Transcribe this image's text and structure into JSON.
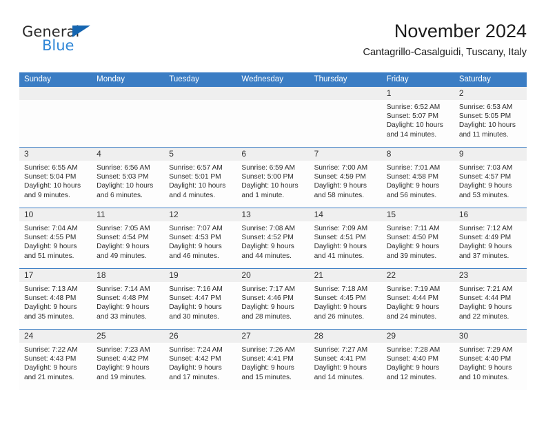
{
  "brand": {
    "name_part1": "General",
    "name_part2": "Blue",
    "triangle_color": "#1565b0",
    "blue_color": "#2f86d6"
  },
  "header": {
    "title": "November 2024",
    "subtitle": "Cantagrillo-Casalguidi, Tuscany, Italy"
  },
  "theme": {
    "accent": "#3b7dc4",
    "daynum_band": "#efefef",
    "cell_bg": "#fdfdfd"
  },
  "calendar": {
    "weekday_headers": [
      "Sunday",
      "Monday",
      "Tuesday",
      "Wednesday",
      "Thursday",
      "Friday",
      "Saturday"
    ],
    "weeks": [
      [
        {
          "day": "",
          "sunrise": "",
          "sunset": "",
          "daylight_line1": "",
          "daylight_line2": ""
        },
        {
          "day": "",
          "sunrise": "",
          "sunset": "",
          "daylight_line1": "",
          "daylight_line2": ""
        },
        {
          "day": "",
          "sunrise": "",
          "sunset": "",
          "daylight_line1": "",
          "daylight_line2": ""
        },
        {
          "day": "",
          "sunrise": "",
          "sunset": "",
          "daylight_line1": "",
          "daylight_line2": ""
        },
        {
          "day": "",
          "sunrise": "",
          "sunset": "",
          "daylight_line1": "",
          "daylight_line2": ""
        },
        {
          "day": "1",
          "sunrise": "Sunrise: 6:52 AM",
          "sunset": "Sunset: 5:07 PM",
          "daylight_line1": "Daylight: 10 hours",
          "daylight_line2": "and 14 minutes."
        },
        {
          "day": "2",
          "sunrise": "Sunrise: 6:53 AM",
          "sunset": "Sunset: 5:05 PM",
          "daylight_line1": "Daylight: 10 hours",
          "daylight_line2": "and 11 minutes."
        }
      ],
      [
        {
          "day": "3",
          "sunrise": "Sunrise: 6:55 AM",
          "sunset": "Sunset: 5:04 PM",
          "daylight_line1": "Daylight: 10 hours",
          "daylight_line2": "and 9 minutes."
        },
        {
          "day": "4",
          "sunrise": "Sunrise: 6:56 AM",
          "sunset": "Sunset: 5:03 PM",
          "daylight_line1": "Daylight: 10 hours",
          "daylight_line2": "and 6 minutes."
        },
        {
          "day": "5",
          "sunrise": "Sunrise: 6:57 AM",
          "sunset": "Sunset: 5:01 PM",
          "daylight_line1": "Daylight: 10 hours",
          "daylight_line2": "and 4 minutes."
        },
        {
          "day": "6",
          "sunrise": "Sunrise: 6:59 AM",
          "sunset": "Sunset: 5:00 PM",
          "daylight_line1": "Daylight: 10 hours",
          "daylight_line2": "and 1 minute."
        },
        {
          "day": "7",
          "sunrise": "Sunrise: 7:00 AM",
          "sunset": "Sunset: 4:59 PM",
          "daylight_line1": "Daylight: 9 hours",
          "daylight_line2": "and 58 minutes."
        },
        {
          "day": "8",
          "sunrise": "Sunrise: 7:01 AM",
          "sunset": "Sunset: 4:58 PM",
          "daylight_line1": "Daylight: 9 hours",
          "daylight_line2": "and 56 minutes."
        },
        {
          "day": "9",
          "sunrise": "Sunrise: 7:03 AM",
          "sunset": "Sunset: 4:57 PM",
          "daylight_line1": "Daylight: 9 hours",
          "daylight_line2": "and 53 minutes."
        }
      ],
      [
        {
          "day": "10",
          "sunrise": "Sunrise: 7:04 AM",
          "sunset": "Sunset: 4:55 PM",
          "daylight_line1": "Daylight: 9 hours",
          "daylight_line2": "and 51 minutes."
        },
        {
          "day": "11",
          "sunrise": "Sunrise: 7:05 AM",
          "sunset": "Sunset: 4:54 PM",
          "daylight_line1": "Daylight: 9 hours",
          "daylight_line2": "and 49 minutes."
        },
        {
          "day": "12",
          "sunrise": "Sunrise: 7:07 AM",
          "sunset": "Sunset: 4:53 PM",
          "daylight_line1": "Daylight: 9 hours",
          "daylight_line2": "and 46 minutes."
        },
        {
          "day": "13",
          "sunrise": "Sunrise: 7:08 AM",
          "sunset": "Sunset: 4:52 PM",
          "daylight_line1": "Daylight: 9 hours",
          "daylight_line2": "and 44 minutes."
        },
        {
          "day": "14",
          "sunrise": "Sunrise: 7:09 AM",
          "sunset": "Sunset: 4:51 PM",
          "daylight_line1": "Daylight: 9 hours",
          "daylight_line2": "and 41 minutes."
        },
        {
          "day": "15",
          "sunrise": "Sunrise: 7:11 AM",
          "sunset": "Sunset: 4:50 PM",
          "daylight_line1": "Daylight: 9 hours",
          "daylight_line2": "and 39 minutes."
        },
        {
          "day": "16",
          "sunrise": "Sunrise: 7:12 AM",
          "sunset": "Sunset: 4:49 PM",
          "daylight_line1": "Daylight: 9 hours",
          "daylight_line2": "and 37 minutes."
        }
      ],
      [
        {
          "day": "17",
          "sunrise": "Sunrise: 7:13 AM",
          "sunset": "Sunset: 4:48 PM",
          "daylight_line1": "Daylight: 9 hours",
          "daylight_line2": "and 35 minutes."
        },
        {
          "day": "18",
          "sunrise": "Sunrise: 7:14 AM",
          "sunset": "Sunset: 4:48 PM",
          "daylight_line1": "Daylight: 9 hours",
          "daylight_line2": "and 33 minutes."
        },
        {
          "day": "19",
          "sunrise": "Sunrise: 7:16 AM",
          "sunset": "Sunset: 4:47 PM",
          "daylight_line1": "Daylight: 9 hours",
          "daylight_line2": "and 30 minutes."
        },
        {
          "day": "20",
          "sunrise": "Sunrise: 7:17 AM",
          "sunset": "Sunset: 4:46 PM",
          "daylight_line1": "Daylight: 9 hours",
          "daylight_line2": "and 28 minutes."
        },
        {
          "day": "21",
          "sunrise": "Sunrise: 7:18 AM",
          "sunset": "Sunset: 4:45 PM",
          "daylight_line1": "Daylight: 9 hours",
          "daylight_line2": "and 26 minutes."
        },
        {
          "day": "22",
          "sunrise": "Sunrise: 7:19 AM",
          "sunset": "Sunset: 4:44 PM",
          "daylight_line1": "Daylight: 9 hours",
          "daylight_line2": "and 24 minutes."
        },
        {
          "day": "23",
          "sunrise": "Sunrise: 7:21 AM",
          "sunset": "Sunset: 4:44 PM",
          "daylight_line1": "Daylight: 9 hours",
          "daylight_line2": "and 22 minutes."
        }
      ],
      [
        {
          "day": "24",
          "sunrise": "Sunrise: 7:22 AM",
          "sunset": "Sunset: 4:43 PM",
          "daylight_line1": "Daylight: 9 hours",
          "daylight_line2": "and 21 minutes."
        },
        {
          "day": "25",
          "sunrise": "Sunrise: 7:23 AM",
          "sunset": "Sunset: 4:42 PM",
          "daylight_line1": "Daylight: 9 hours",
          "daylight_line2": "and 19 minutes."
        },
        {
          "day": "26",
          "sunrise": "Sunrise: 7:24 AM",
          "sunset": "Sunset: 4:42 PM",
          "daylight_line1": "Daylight: 9 hours",
          "daylight_line2": "and 17 minutes."
        },
        {
          "day": "27",
          "sunrise": "Sunrise: 7:26 AM",
          "sunset": "Sunset: 4:41 PM",
          "daylight_line1": "Daylight: 9 hours",
          "daylight_line2": "and 15 minutes."
        },
        {
          "day": "28",
          "sunrise": "Sunrise: 7:27 AM",
          "sunset": "Sunset: 4:41 PM",
          "daylight_line1": "Daylight: 9 hours",
          "daylight_line2": "and 14 minutes."
        },
        {
          "day": "29",
          "sunrise": "Sunrise: 7:28 AM",
          "sunset": "Sunset: 4:40 PM",
          "daylight_line1": "Daylight: 9 hours",
          "daylight_line2": "and 12 minutes."
        },
        {
          "day": "30",
          "sunrise": "Sunrise: 7:29 AM",
          "sunset": "Sunset: 4:40 PM",
          "daylight_line1": "Daylight: 9 hours",
          "daylight_line2": "and 10 minutes."
        }
      ]
    ]
  }
}
